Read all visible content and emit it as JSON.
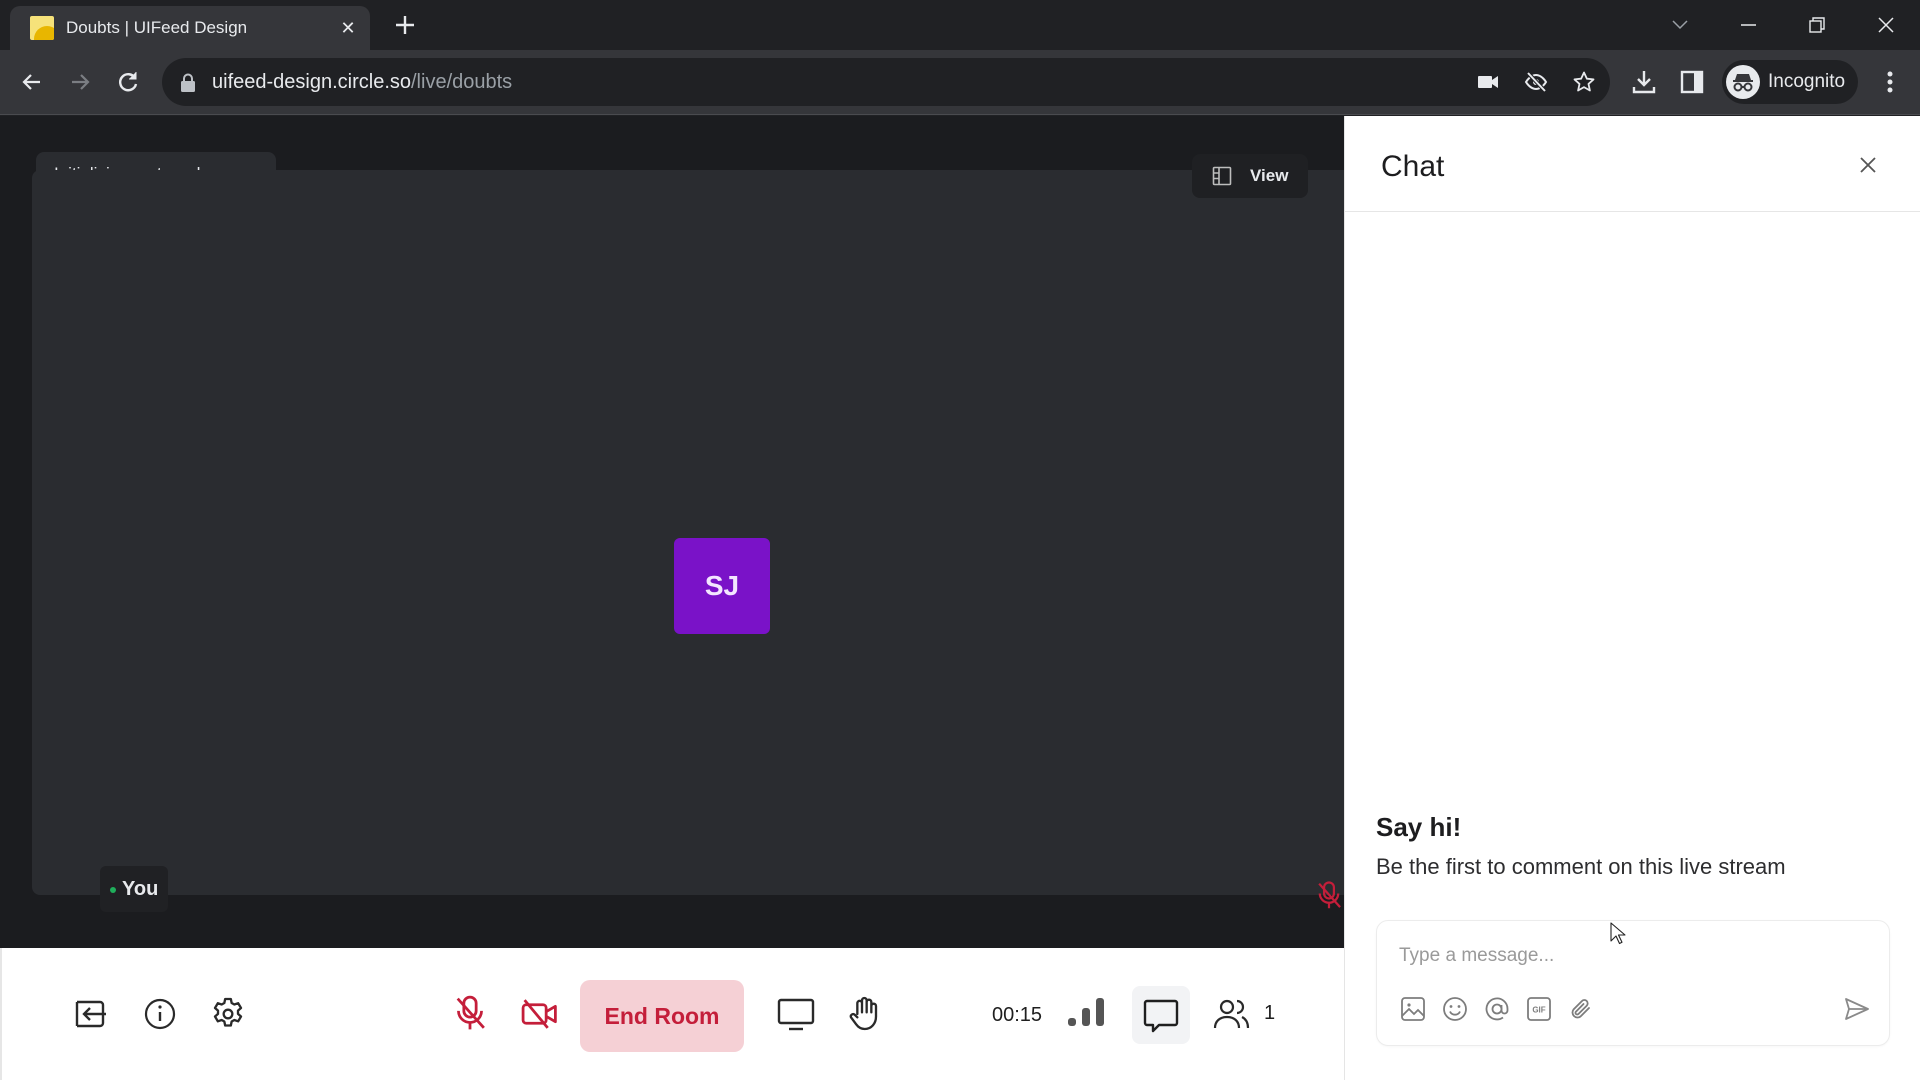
{
  "browser": {
    "tab_title": "Doubts | UIFeed Design",
    "url_host": "uifeed-design.circle.so",
    "url_path": "/live/doubts",
    "profile_label": "Incognito",
    "icons": {
      "back": "arrow-left-icon",
      "forward": "arrow-right-icon",
      "reload": "reload-icon",
      "lock": "lock-icon",
      "camera": "camera-icon",
      "tracking": "eye-off-icon",
      "bookmark": "star-icon",
      "downloads": "download-icon",
      "side_panel": "side-panel-icon",
      "menu": "kebab-menu-icon",
      "tab_list": "chevron-down-icon",
      "minimize": "minimize-icon",
      "restore": "restore-icon",
      "close": "close-icon"
    }
  },
  "stage": {
    "status_text": "Initializing, get ready...",
    "view_label": "View",
    "participant": {
      "initials": "SJ",
      "avatar_color": "#7a12c8",
      "name_label": "You",
      "online_color": "#1fae5b",
      "mic_muted": true
    }
  },
  "controls": {
    "end_room_label": "End Room",
    "timer": "00:15",
    "participant_count": "1",
    "accent_danger": "#c41e3a",
    "icons": [
      "leave-icon",
      "info-icon",
      "settings-icon",
      "mic-off-icon",
      "camera-off-icon",
      "screen-share-icon",
      "raise-hand-icon",
      "signal-icon",
      "chat-icon",
      "participants-icon"
    ]
  },
  "chat": {
    "title": "Chat",
    "empty_title": "Say hi!",
    "empty_subtitle": "Be the first to comment on this live stream",
    "input_placeholder": "Type a message...",
    "input_value": "",
    "composer_icons": [
      "image-icon",
      "emoji-icon",
      "mention-icon",
      "gif-icon",
      "attachment-icon",
      "send-icon"
    ]
  }
}
